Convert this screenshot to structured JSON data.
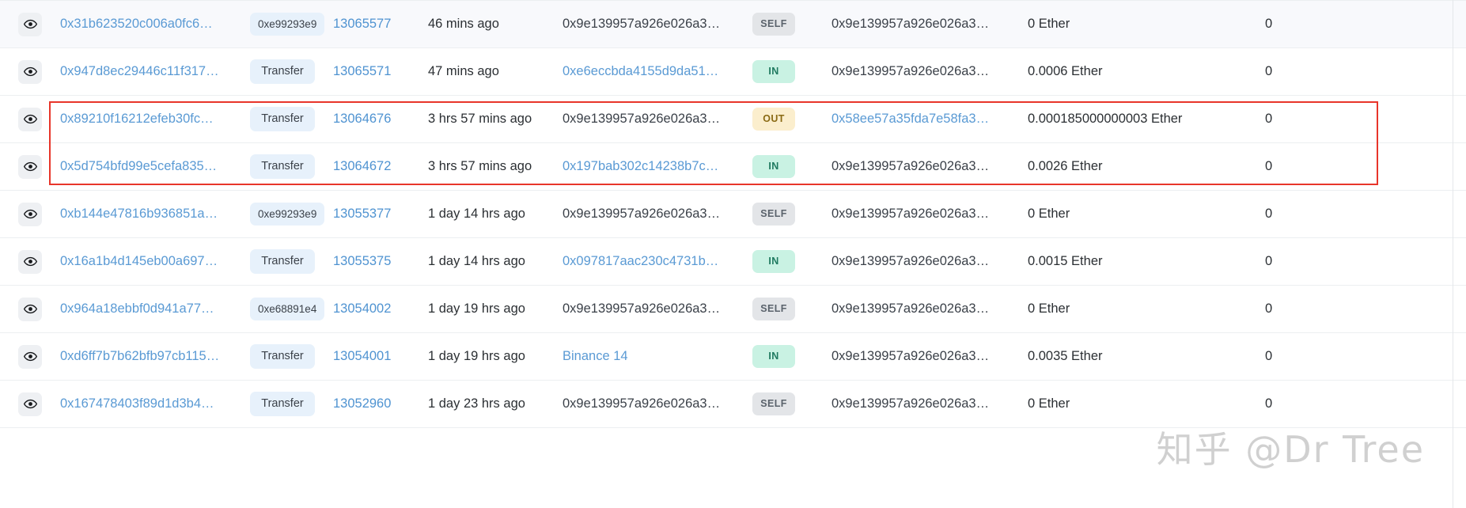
{
  "table": {
    "columns": [
      "view",
      "txn_hash",
      "method",
      "block",
      "age",
      "from",
      "direction",
      "to",
      "value",
      "txn_fee"
    ],
    "icons": {
      "view": "eye-icon"
    },
    "rows": [
      {
        "hash": "0x31b623520c006a0fc6…",
        "method": "0xe99293e9",
        "block": "13065577",
        "age": "46 mins ago",
        "from": "0x9e139957a926e026a3…",
        "from_is_link": false,
        "direction": "SELF",
        "to": "0x9e139957a926e026a3…",
        "to_is_link": false,
        "value": "0 Ether",
        "fee": "0",
        "highlighted": false,
        "selected": true
      },
      {
        "hash": "0x947d8ec29446c11f317…",
        "method": "Transfer",
        "block": "13065571",
        "age": "47 mins ago",
        "from": "0xe6eccbda4155d9da51…",
        "from_is_link": true,
        "direction": "IN",
        "to": "0x9e139957a926e026a3…",
        "to_is_link": false,
        "value": "0.0006 Ether",
        "fee": "0",
        "highlighted": false,
        "selected": false
      },
      {
        "hash": "0x89210f16212efeb30fc…",
        "method": "Transfer",
        "block": "13064676",
        "age": "3 hrs 57 mins ago",
        "from": "0x9e139957a926e026a3…",
        "from_is_link": false,
        "direction": "OUT",
        "to": "0x58ee57a35fda7e58fa3…",
        "to_is_link": true,
        "value": "0.000185000000003 Ether",
        "fee": "0",
        "highlighted": true,
        "selected": false
      },
      {
        "hash": "0x5d754bfd99e5cefa835…",
        "method": "Transfer",
        "block": "13064672",
        "age": "3 hrs 57 mins ago",
        "from": "0x197bab302c14238b7c…",
        "from_is_link": true,
        "direction": "IN",
        "to": "0x9e139957a926e026a3…",
        "to_is_link": false,
        "value": "0.0026 Ether",
        "fee": "0",
        "highlighted": true,
        "selected": false
      },
      {
        "hash": "0xb144e47816b936851a…",
        "method": "0xe99293e9",
        "block": "13055377",
        "age": "1 day 14 hrs ago",
        "from": "0x9e139957a926e026a3…",
        "from_is_link": false,
        "direction": "SELF",
        "to": "0x9e139957a926e026a3…",
        "to_is_link": false,
        "value": "0 Ether",
        "fee": "0",
        "highlighted": false,
        "selected": false
      },
      {
        "hash": "0x16a1b4d145eb00a697…",
        "method": "Transfer",
        "block": "13055375",
        "age": "1 day 14 hrs ago",
        "from": "0x097817aac230c4731b…",
        "from_is_link": true,
        "direction": "IN",
        "to": "0x9e139957a926e026a3…",
        "to_is_link": false,
        "value": "0.0015 Ether",
        "fee": "0",
        "highlighted": false,
        "selected": false
      },
      {
        "hash": "0x964a18ebbf0d941a77…",
        "method": "0xe68891e4",
        "block": "13054002",
        "age": "1 day 19 hrs ago",
        "from": "0x9e139957a926e026a3…",
        "from_is_link": false,
        "direction": "SELF",
        "to": "0x9e139957a926e026a3…",
        "to_is_link": false,
        "value": "0 Ether",
        "fee": "0",
        "highlighted": false,
        "selected": false
      },
      {
        "hash": "0xd6ff7b7b62bfb97cb115…",
        "method": "Transfer",
        "block": "13054001",
        "age": "1 day 19 hrs ago",
        "from": "Binance 14",
        "from_is_link": true,
        "direction": "IN",
        "to": "0x9e139957a926e026a3…",
        "to_is_link": false,
        "value": "0.0035 Ether",
        "fee": "0",
        "highlighted": false,
        "selected": false
      },
      {
        "hash": "0x167478403f89d1d3b4…",
        "method": "Transfer",
        "block": "13052960",
        "age": "1 day 23 hrs ago",
        "from": "0x9e139957a926e026a3…",
        "from_is_link": false,
        "direction": "SELF",
        "to": "0x9e139957a926e026a3…",
        "to_is_link": false,
        "value": "0 Ether",
        "fee": "0",
        "highlighted": false,
        "selected": false
      }
    ]
  },
  "annotation": {
    "highlight_color": "#e8352a",
    "highlight_row_indices": [
      2,
      3
    ]
  },
  "watermark": {
    "text": "知乎 @Dr Tree"
  },
  "colors": {
    "link": "#5a9ad4",
    "badge_self_bg": "#e3e5e8",
    "badge_in_bg": "#c9f2e3",
    "badge_out_bg": "#fbeecd",
    "method_pill_bg": "#e7f1fb",
    "selected_row_bg": "#f8f9fc"
  }
}
